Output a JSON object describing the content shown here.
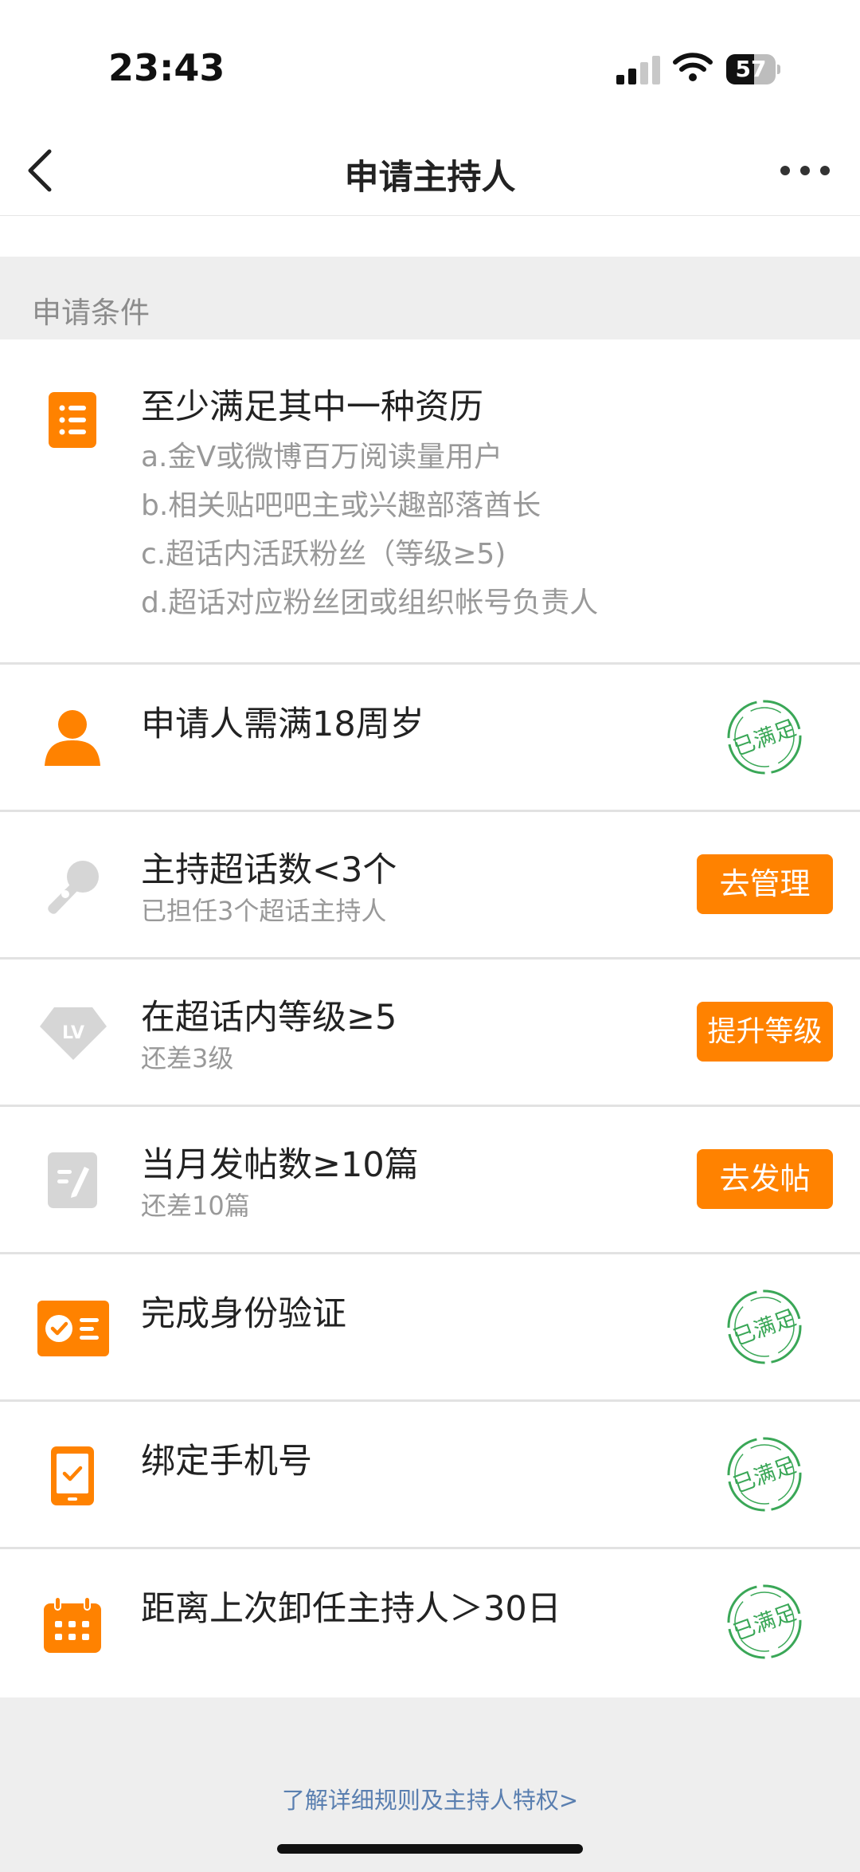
{
  "status_bar": {
    "time": "23:43",
    "battery_level": "57",
    "battery_fraction": 0.57
  },
  "nav": {
    "title": "申请主持人",
    "back_icon": "chevron-left-icon",
    "more_icon": "more-dots-icon"
  },
  "section_label": "申请条件",
  "qualification": {
    "icon": "list-icon",
    "title": "至少满足其中一种资历",
    "items": [
      "a.金V或微博百万阅读量用户",
      "b.相关贴吧吧主或兴趣部落酋长",
      "c.超话内活跃粉丝（等级≥5)",
      "d.超话对应粉丝团或组织帐号负责人"
    ]
  },
  "conditions": [
    {
      "id": "age",
      "icon": "person-icon",
      "title": "申请人需满18周岁",
      "subtitle": "",
      "status": "已满足"
    },
    {
      "id": "host-count",
      "icon": "microphone-icon",
      "title": "主持超话数<3个",
      "subtitle": "已担任3个超话主持人",
      "action": "去管理"
    },
    {
      "id": "level",
      "icon": "lv-badge-icon",
      "title": "在超话内等级≥5",
      "subtitle": "还差3级",
      "action": "提升等级"
    },
    {
      "id": "posts",
      "icon": "edit-note-icon",
      "title": "当月发帖数≥10篇",
      "subtitle": "还差10篇",
      "action": "去发帖"
    },
    {
      "id": "identity",
      "icon": "id-card-icon",
      "title": "完成身份验证",
      "subtitle": "",
      "status": "已满足"
    },
    {
      "id": "phone",
      "icon": "phone-check-icon",
      "title": "绑定手机号",
      "subtitle": "",
      "status": "已满足"
    },
    {
      "id": "resign",
      "icon": "calendar-icon",
      "title": "距离上次卸任主持人＞30日",
      "subtitle": "",
      "status": "已满足"
    }
  ],
  "footer_link": "了解详细规则及主持人特权>",
  "colors": {
    "accent": "#ff8200",
    "success": "#3aa757",
    "link": "#5a7fb0",
    "icon_gray": "#d6d6d6"
  }
}
